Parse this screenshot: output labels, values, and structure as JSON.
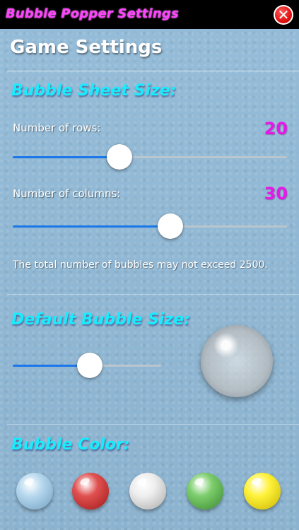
{
  "window": {
    "title": "Bubble Popper Settings",
    "close_glyph": "✕"
  },
  "page": {
    "heading": "Game Settings"
  },
  "sheet_size": {
    "title": "Bubble Sheet Size:",
    "rows": {
      "label": "Number of rows:",
      "value": "20",
      "fraction": 0.39
    },
    "columns": {
      "label": "Number of columns:",
      "value": "30",
      "fraction": 0.574
    },
    "note": "The total number of bubbles may not exceed 2500."
  },
  "bubble_size": {
    "title": "Default Bubble Size:",
    "fraction": 0.52
  },
  "bubble_color": {
    "title": "Bubble Color:",
    "swatches": [
      {
        "name": "clear",
        "color": "#b7d8ee",
        "edge": "#6f9fc2"
      },
      {
        "name": "red",
        "color": "#e05050",
        "edge": "#a01818"
      },
      {
        "name": "white",
        "color": "#eeeeee",
        "edge": "#a8a8a8"
      },
      {
        "name": "green",
        "color": "#7ccd6c",
        "edge": "#3a8a30"
      },
      {
        "name": "yellow",
        "color": "#fff23a",
        "edge": "#c8b400"
      }
    ]
  },
  "colors": {
    "accent_cyan": "#19ecff",
    "value_magenta": "#e817e8",
    "slider_blue": "#1a77ea",
    "title_pink": "#ff44ff"
  }
}
